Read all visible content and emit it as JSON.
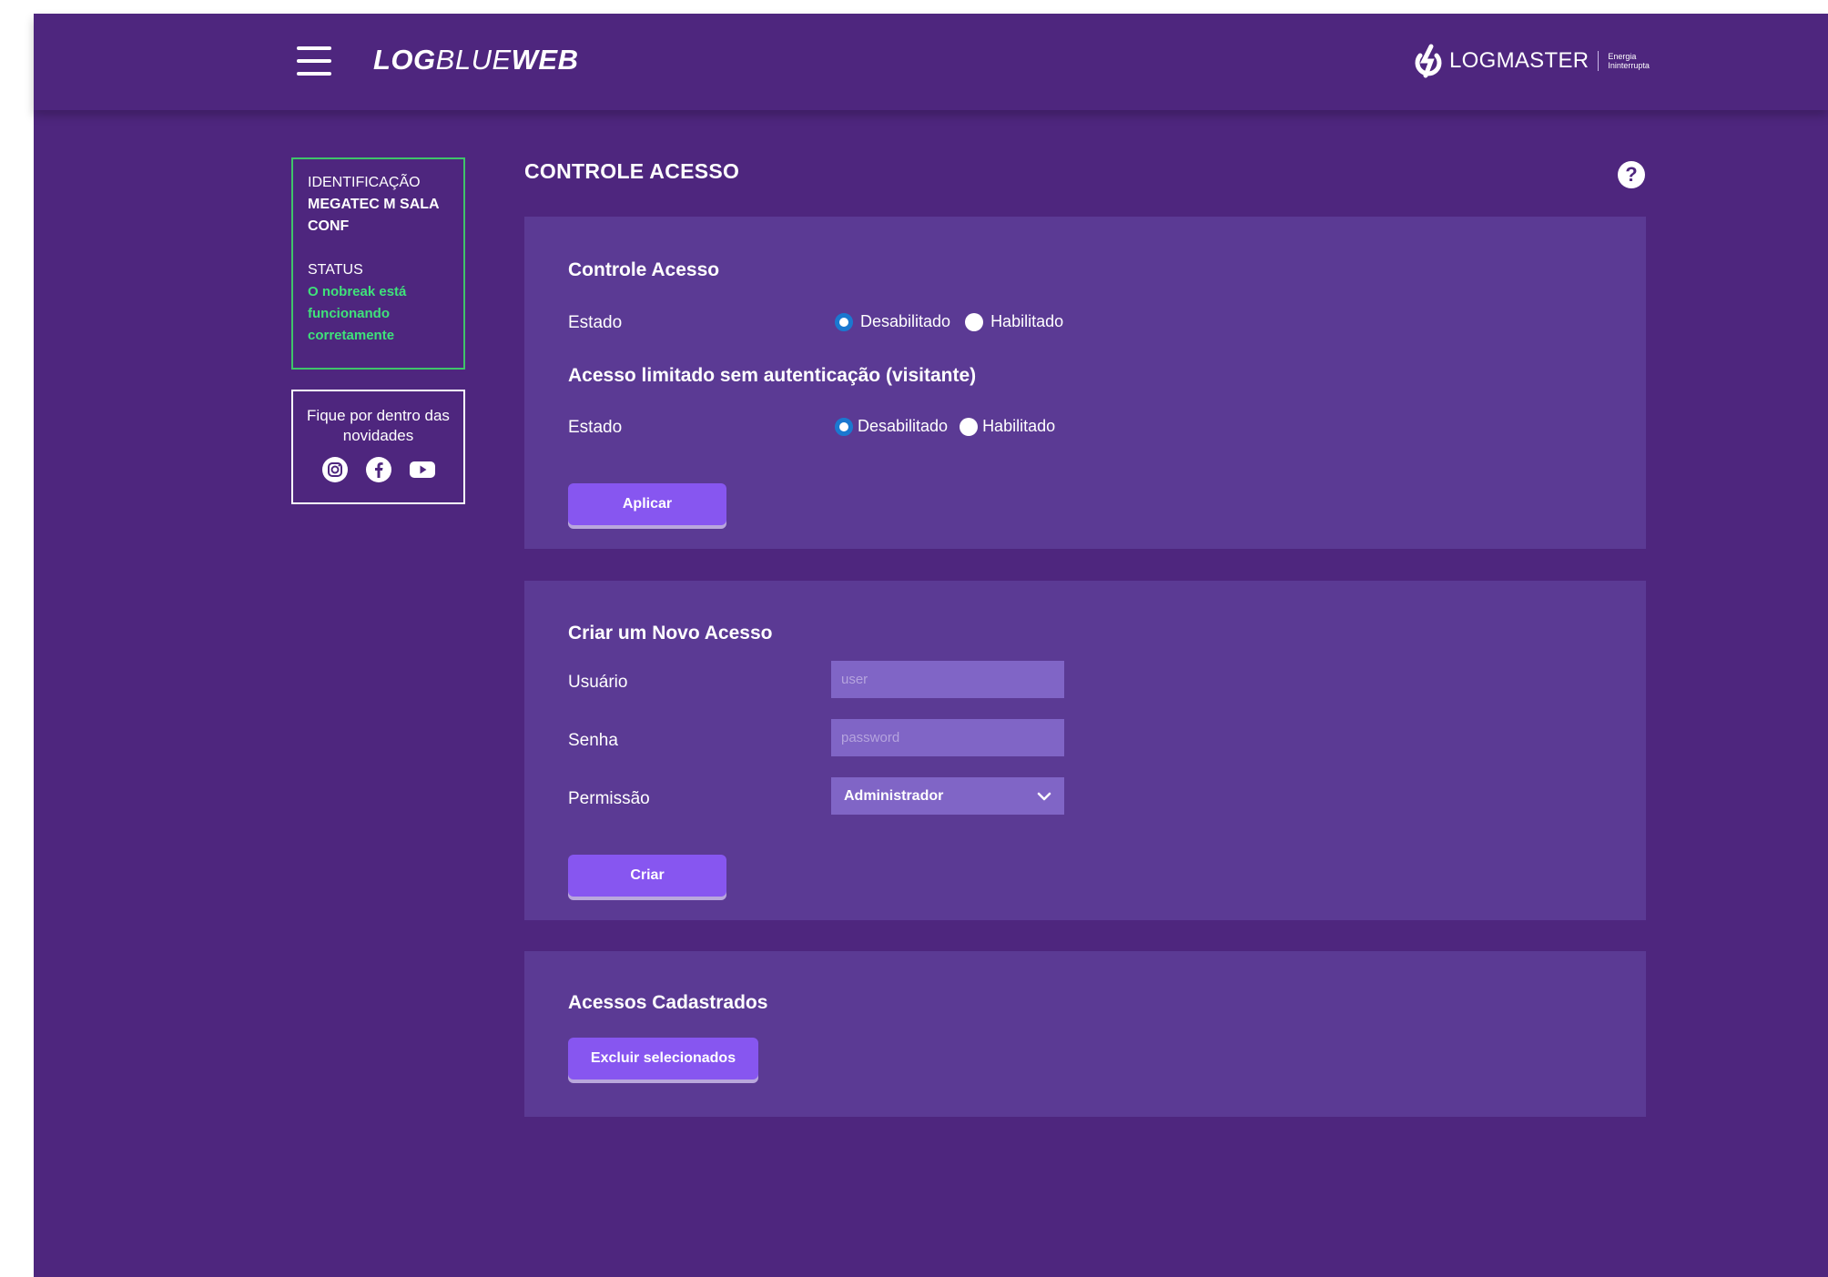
{
  "header": {
    "brand_bold": "LOG",
    "brand_thin": "BLUE",
    "brand_bold_end": "WEB",
    "partner_name": "LOGMASTER",
    "partner_tag": "Energia Ininterrupta"
  },
  "sidebar": {
    "id_label": "IDENTIFICAÇÃO",
    "id_value": "MEGATEC M SALA CONF",
    "status_label": "STATUS",
    "status_value": "O nobreak está funcionando corretamente",
    "news_text": "Fique por dentro das novidades"
  },
  "page": {
    "title": "CONTROLE ACESSO",
    "help": "?"
  },
  "access_control": {
    "title": "Controle Acesso",
    "state_label": "Estado",
    "opt_disabled": "Desabilitado",
    "opt_enabled": "Habilitado",
    "selected": "Desabilitado"
  },
  "limited_access": {
    "title": "Acesso limitado sem autenticação (visitante)",
    "state_label": "Estado",
    "opt_disabled": "Desabilitado",
    "opt_enabled": "Habilitado",
    "selected": "Desabilitado",
    "apply_button": "Aplicar"
  },
  "new_access": {
    "title": "Criar um Novo Acesso",
    "user_label": "Usuário",
    "user_placeholder": "user",
    "password_label": "Senha",
    "password_placeholder": "password",
    "permission_label": "Permissão",
    "permission_value": "Administrador",
    "create_button": "Criar"
  },
  "registered": {
    "title": "Acessos Cadastrados",
    "delete_button": "Excluir selecionados"
  },
  "colors": {
    "background": "#4e267e",
    "panel": "#5b3a94",
    "button": "#8756f0",
    "status_ok": "#3fe27a",
    "radio_checked": "#1b78d0"
  }
}
